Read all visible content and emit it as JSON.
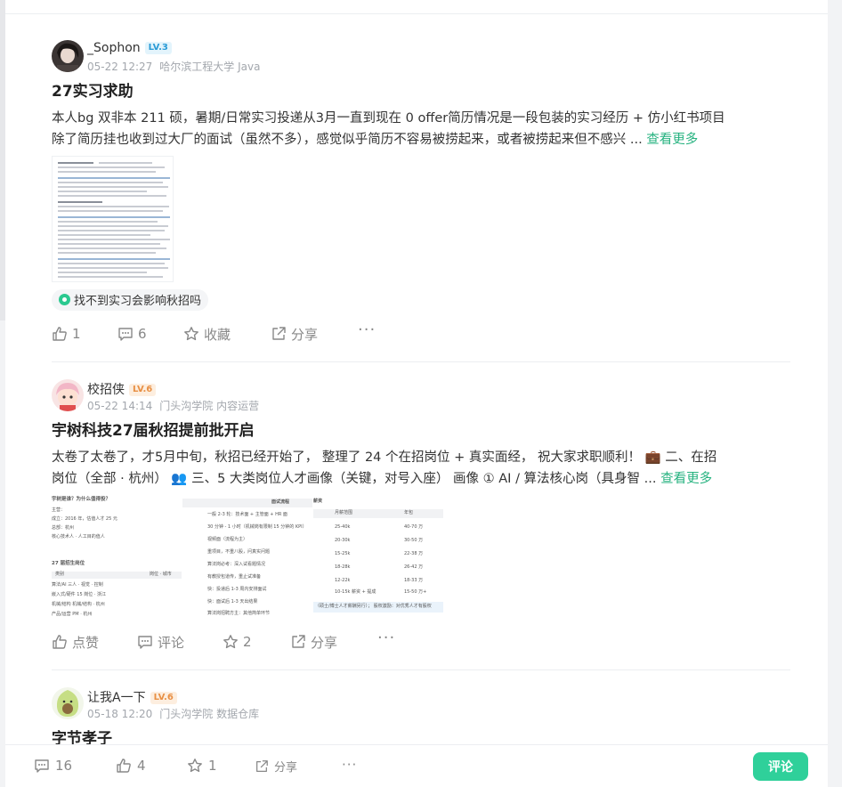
{
  "posts": [
    {
      "author": "_Sophon",
      "level": "LV.3",
      "date": "05-22 12:27",
      "affiliation": "哈尔滨工程大学 Java",
      "title": "27实习求助",
      "body_lines": [
        "本人bg 双非本 211 硕，暑期/日常实习投递从3月一直到现在 0 offer简历情况是一段包装的实习经历 + 仿小红书项目",
        "除了简历挂也收到过大厂的面试（虽然不多），感觉似乎简历不容易被捞起来，或者被捞起来但不感兴 ..."
      ],
      "more_label": "查看更多",
      "tag": "找不到实习会影响秋招吗",
      "actions": {
        "like": "1",
        "comment": "6",
        "favorite": "收藏",
        "share": "分享",
        "more": "···"
      }
    },
    {
      "author": "校招侠",
      "level": "LV.6",
      "date": "05-22 14:14",
      "affiliation": "门头沟学院 内容运营",
      "title": "宇树科技27届秋招提前批开启",
      "body_lines": [
        "太卷了太卷了，才5月中旬，秋招已经开始了， 整理了 24 个在招岗位 + 真实面经， 祝大家求职顺利！  💼 二、在招",
        "岗位（全部 · 杭州）  👥 三、5 大类岗位人才画像（关键，对号入座） 画像 ① AI / 算法核心岗（具身智 ..."
      ],
      "more_label": "查看更多",
      "image1": {
        "heading": "宇树是谁？为什么值得投？",
        "rows": [
          "主营：",
          "成立：2016 年，估值人才 25 元",
          "总部：杭州",
          "核心技术人 · 人工目的值人"
        ],
        "heading2": "27 届招生岗位",
        "cols": [
          "类别",
          "岗位 · 城市"
        ],
        "table": [
          "算法/AI  三人 · 视觉 · 控制",
          "嵌入式/硬件  15 岗位 · 浙江",
          "机械/结构  机械/结构 · 杭州",
          "产品/运营  PM · 杭州"
        ]
      },
      "image2": {
        "title": "面试流程",
        "rows": [
          "一般 2-3 轮：技术面 + 主管面 + HR 面",
          "30 分钟 - 1 小时（机械岗有限制 15 分钟的 KPI）",
          "视频面（流程为主）",
          "重项目，不重八股，问真实问题",
          "算法岗必考：深入试看题情况",
          "有教授包道传，重止试准备",
          "快：投递后 1-3 周内安排面试",
          "快：面试后 1-3 天出结果",
          "算法岗招聘方主：其他简单环节"
        ]
      },
      "image3": {
        "title": "薪资",
        "cols": [
          "月薪范围",
          "年包"
        ],
        "rows": [
          [
            "25-40k",
            "40-70 万"
          ],
          [
            "20-30k",
            "30-50 万"
          ],
          [
            "15-25k",
            "22-38 万"
          ],
          [
            "18-28k",
            "26-42 万"
          ],
          [
            "12-22k",
            "18-33 万"
          ],
          [
            "10-15k 薪资 + 提成",
            "15-50 万+"
          ]
        ],
        "footer": "（硕士/博士人才薪酬另行）； 股权激励：对优秀人才有股权"
      },
      "actions": {
        "like": "点赞",
        "comment": "评论",
        "favorite": "2",
        "share": "分享",
        "more": "···"
      }
    },
    {
      "author": "让我A一下",
      "level": "LV.6",
      "date": "05-18 12:20",
      "affiliation": "门头沟学院 数据仓库",
      "title": "字节孝子"
    }
  ],
  "bottom_bar": {
    "comment_count": "16",
    "like_count": "4",
    "favorite_count": "1",
    "share_label": "分享",
    "more": "···",
    "comment_button": "评论"
  },
  "colors": {
    "accent": "#2fd09a",
    "link": "#25b27f",
    "muted": "#a3a7ad"
  },
  "icons": [
    "thumbs-up-icon",
    "comment-icon",
    "star-icon",
    "share-icon",
    "more-dots-icon",
    "tag-dot-icon"
  ]
}
